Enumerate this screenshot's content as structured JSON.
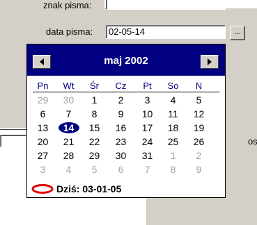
{
  "form": {
    "znak_label": "znak pisma:",
    "data_label": "data pisma:",
    "data_value": "02-05-14",
    "browse_label": "...",
    "side_text": "os"
  },
  "calendar": {
    "title": "maj 2002",
    "weekdays": [
      "Pn",
      "Wt",
      "Śr",
      "Cz",
      "Pt",
      "So",
      "N"
    ],
    "weeks": [
      [
        "29",
        "30",
        "1",
        "2",
        "3",
        "4",
        "5"
      ],
      [
        "6",
        "7",
        "8",
        "9",
        "10",
        "11",
        "12"
      ],
      [
        "13",
        "14",
        "15",
        "16",
        "17",
        "18",
        "19"
      ],
      [
        "20",
        "21",
        "22",
        "23",
        "24",
        "25",
        "26"
      ],
      [
        "27",
        "28",
        "29",
        "30",
        "31",
        "1",
        "2"
      ],
      [
        "3",
        "4",
        "5",
        "6",
        "7",
        "8",
        "9"
      ]
    ],
    "selected_day": "14",
    "today_text": "Dziś: 03-01-05"
  },
  "colors": {
    "header_bg": "#000080",
    "selection": "#000080",
    "today_marker": "#e00000"
  }
}
